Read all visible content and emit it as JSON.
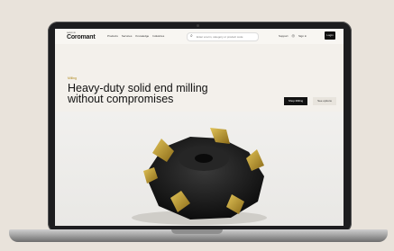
{
  "nav": {
    "logo_small": "SANDVIK",
    "logo": "Coromant",
    "links": [
      "Products",
      "Services",
      "Knowledge",
      "Industries"
    ],
    "search_placeholder": "Enter a term, category or product code",
    "support": "Support",
    "sign_in": "Sign in",
    "login": "Login"
  },
  "hero": {
    "eyebrow": "Milling",
    "headline": "Heavy-duty solid end milling without compromises",
    "primary_button": "Shop Milling",
    "secondary_button": "See options"
  },
  "icons": {
    "search": "search-icon",
    "globe": "globe-icon"
  },
  "colors": {
    "accent": "#b08a1e",
    "dark": "#111111",
    "insert_gold": "#c9a63a"
  }
}
